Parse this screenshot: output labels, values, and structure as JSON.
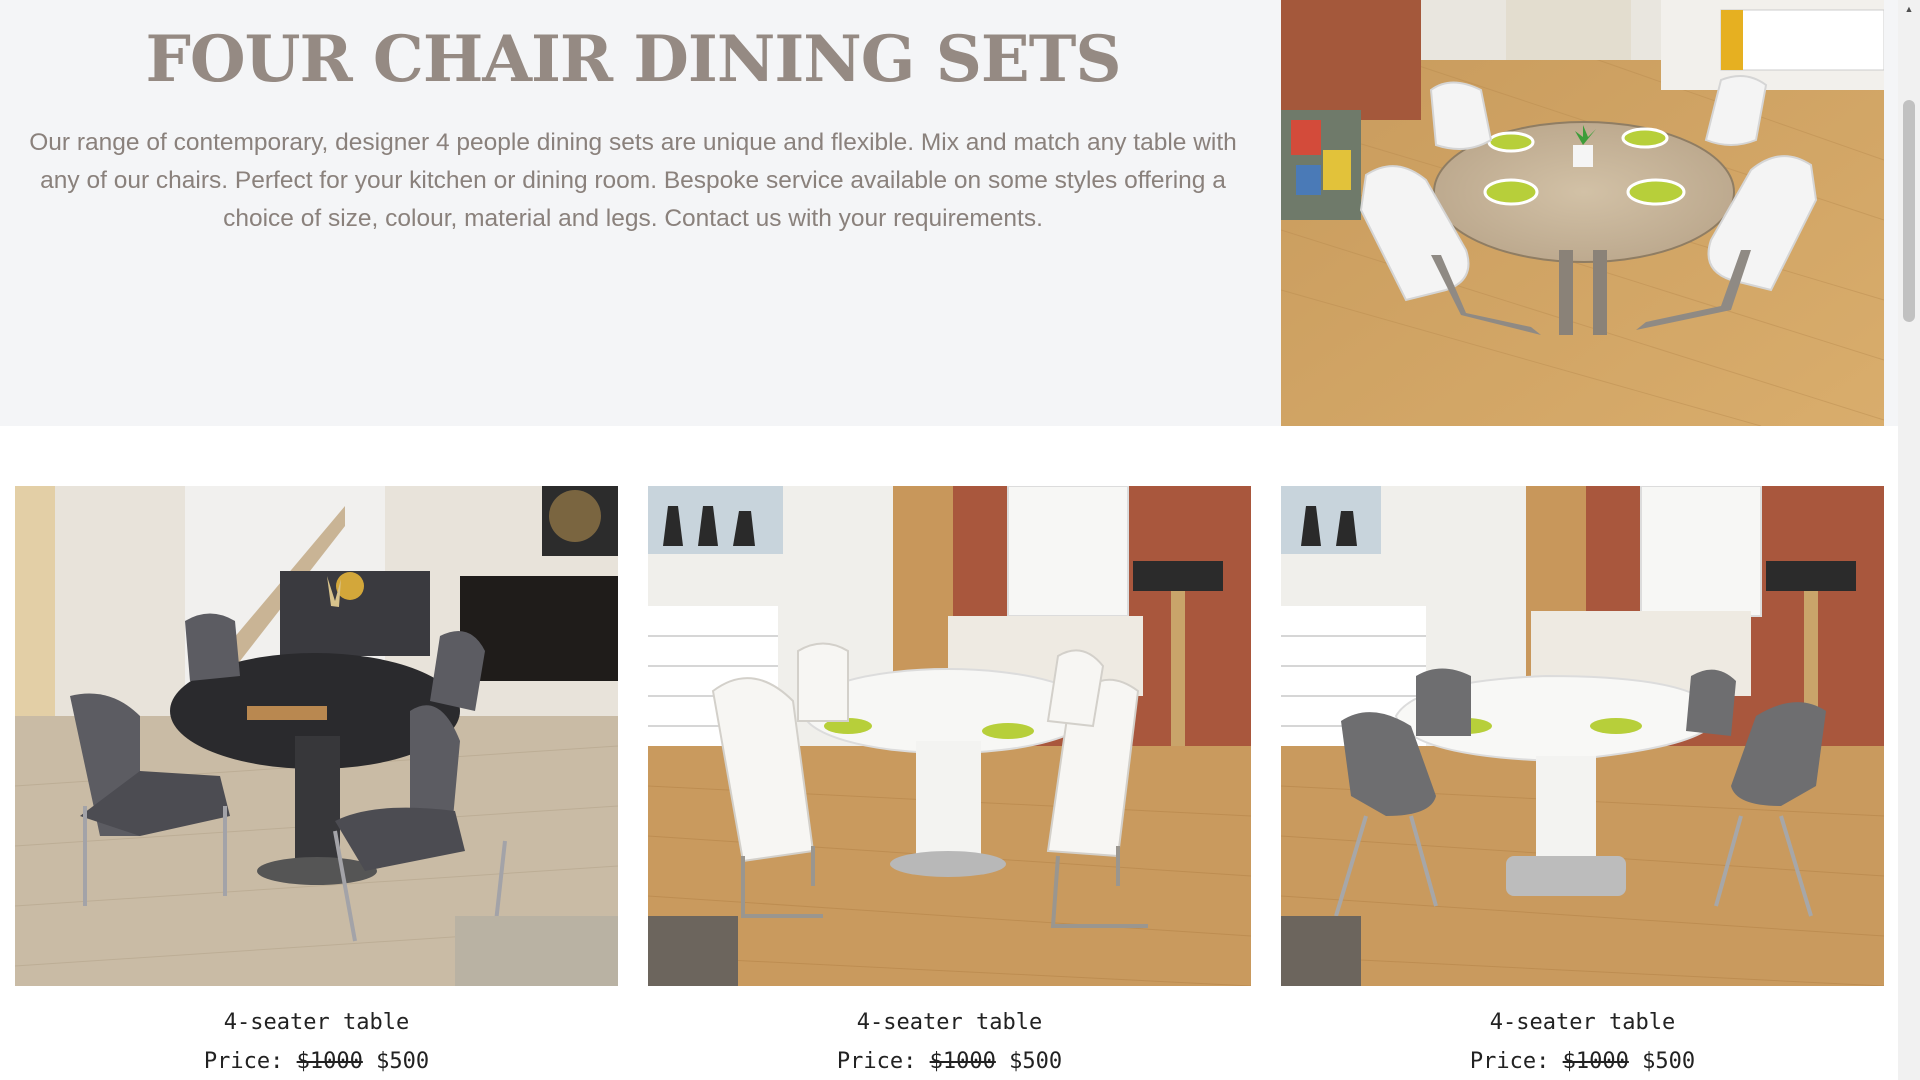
{
  "hero": {
    "title": "FOUR CHAIR DINING SETS",
    "description": "Our range of contemporary, designer 4 people dining sets are unique and flexible. Mix and match any table with any of our chairs. Perfect for your kitchen or dining room. Bespoke service available on some styles offering a choice of size, colour, material and legs. Contact us with your requirements."
  },
  "products": [
    {
      "name": "4-seater table",
      "price_label": "Price:",
      "old_price": "$1000",
      "new_price": "$500"
    },
    {
      "name": "4-seater table",
      "price_label": "Price:",
      "old_price": "$1000",
      "new_price": "$500"
    },
    {
      "name": "4-seater table",
      "price_label": "Price:",
      "old_price": "$1000",
      "new_price": "$500"
    }
  ],
  "scrollbar": {
    "up_arrow_icon": "triangle-up-icon"
  }
}
